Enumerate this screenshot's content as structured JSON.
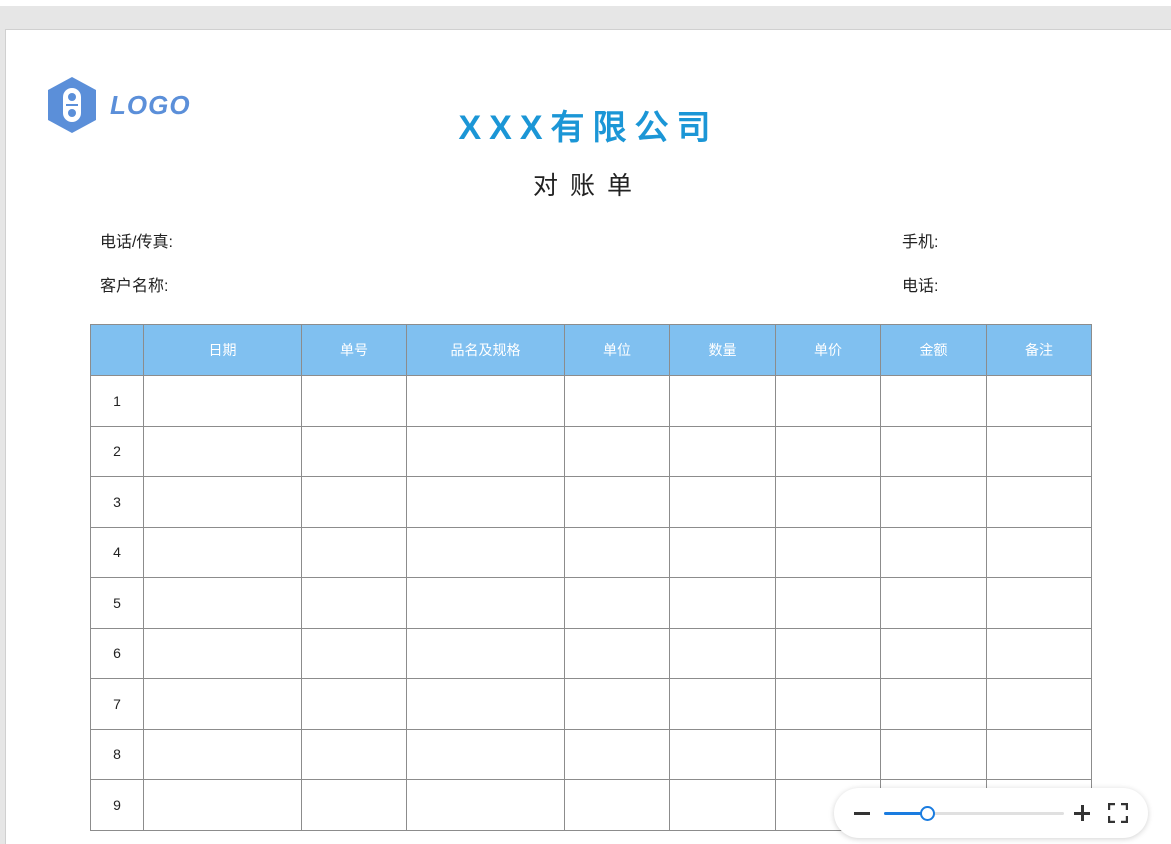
{
  "document": {
    "logo_text": "LOGO",
    "company_name": "XXX有限公司",
    "title": "对账单",
    "fields": {
      "phone_fax": "电话/传真:",
      "mobile": "手机:",
      "customer_name": "客户名称:",
      "phone": "电话:"
    }
  },
  "table": {
    "headers": [
      "",
      "日期",
      "单号",
      "品名及规格",
      "单位",
      "数量",
      "单价",
      "金额",
      "备注"
    ],
    "row_numbers": [
      "1",
      "2",
      "3",
      "4",
      "5",
      "6",
      "7",
      "8",
      "9"
    ]
  },
  "zoom": {
    "level": 0.24
  },
  "colors": {
    "company": "#1b96d6",
    "header_bg": "#80c0f0",
    "logo": "#5b8fd9",
    "accent": "#1a7ce0"
  }
}
